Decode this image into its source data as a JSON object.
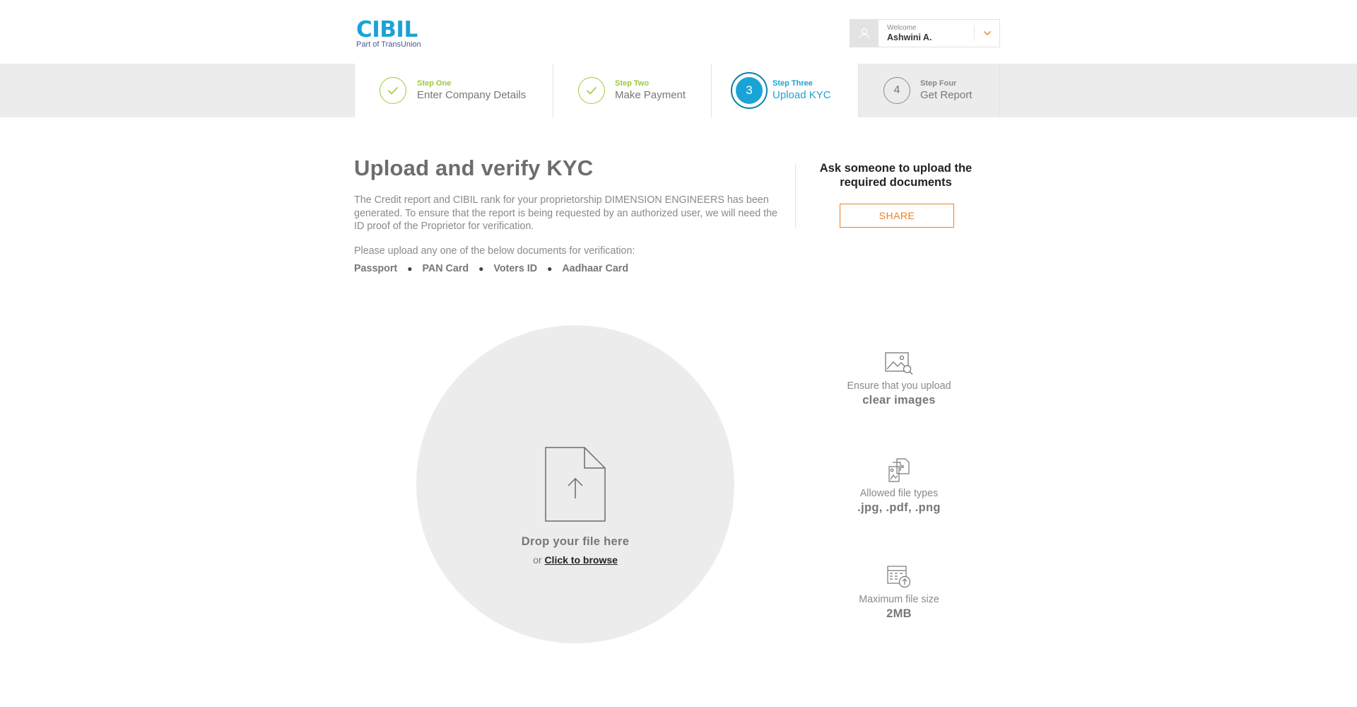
{
  "header": {
    "logo_main": "CIBIL",
    "logo_sub": "Part of TransUnion",
    "user": {
      "welcome": "Welcome",
      "name": "Ashwini A."
    }
  },
  "stepper": {
    "steps": [
      {
        "kicker": "Step One",
        "title": "Enter Company Details",
        "status": "completed"
      },
      {
        "kicker": "Step Two",
        "title": "Make Payment",
        "status": "completed"
      },
      {
        "kicker": "Step Three",
        "title": "Upload KYC",
        "number": "3",
        "status": "current"
      },
      {
        "kicker": "Step Four",
        "title": "Get Report",
        "number": "4",
        "status": "pending"
      }
    ]
  },
  "main": {
    "title": "Upload and verify KYC",
    "intro": "The Credit report and CIBIL rank for your proprietorship DIMENSION ENGINEERS has been generated. To ensure that the report is being requested by an authorized user, we will need the ID proof of the Proprietor for verification.",
    "upload_prompt": "Please upload any one of the below documents for verification:",
    "documents": [
      "Passport",
      "PAN Card",
      "Voters ID",
      "Aadhaar Card"
    ]
  },
  "share": {
    "heading": "Ask someone to upload the required documents",
    "button_label": "SHARE"
  },
  "dropzone": {
    "title": "Drop your file here",
    "or_text": "or",
    "browse_label": "Click to browse"
  },
  "requirements": [
    {
      "icon": "image-search-icon",
      "label": "Ensure that you upload",
      "value": "clear images"
    },
    {
      "icon": "file-types-icon",
      "label": "Allowed file types",
      "value": ".jpg, .pdf, .png"
    },
    {
      "icon": "file-size-icon",
      "label": "Maximum file size",
      "value": "2MB"
    }
  ],
  "colors": {
    "brand_blue": "#1aa3d6",
    "success_green": "#9acb3b",
    "accent_orange": "#f07f1f"
  }
}
